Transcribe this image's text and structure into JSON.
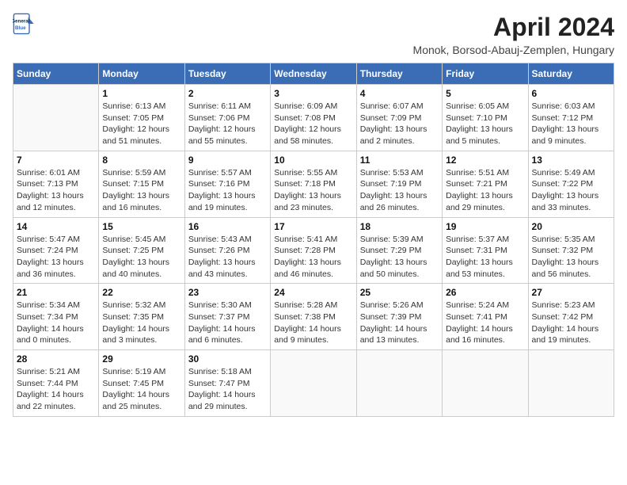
{
  "header": {
    "logo_line1": "General",
    "logo_line2": "Blue",
    "month_title": "April 2024",
    "location": "Monok, Borsod-Abauj-Zemplen, Hungary"
  },
  "weekdays": [
    "Sunday",
    "Monday",
    "Tuesday",
    "Wednesday",
    "Thursday",
    "Friday",
    "Saturday"
  ],
  "weeks": [
    [
      {
        "day": "",
        "info": ""
      },
      {
        "day": "1",
        "info": "Sunrise: 6:13 AM\nSunset: 7:05 PM\nDaylight: 12 hours\nand 51 minutes."
      },
      {
        "day": "2",
        "info": "Sunrise: 6:11 AM\nSunset: 7:06 PM\nDaylight: 12 hours\nand 55 minutes."
      },
      {
        "day": "3",
        "info": "Sunrise: 6:09 AM\nSunset: 7:08 PM\nDaylight: 12 hours\nand 58 minutes."
      },
      {
        "day": "4",
        "info": "Sunrise: 6:07 AM\nSunset: 7:09 PM\nDaylight: 13 hours\nand 2 minutes."
      },
      {
        "day": "5",
        "info": "Sunrise: 6:05 AM\nSunset: 7:10 PM\nDaylight: 13 hours\nand 5 minutes."
      },
      {
        "day": "6",
        "info": "Sunrise: 6:03 AM\nSunset: 7:12 PM\nDaylight: 13 hours\nand 9 minutes."
      }
    ],
    [
      {
        "day": "7",
        "info": "Sunrise: 6:01 AM\nSunset: 7:13 PM\nDaylight: 13 hours\nand 12 minutes."
      },
      {
        "day": "8",
        "info": "Sunrise: 5:59 AM\nSunset: 7:15 PM\nDaylight: 13 hours\nand 16 minutes."
      },
      {
        "day": "9",
        "info": "Sunrise: 5:57 AM\nSunset: 7:16 PM\nDaylight: 13 hours\nand 19 minutes."
      },
      {
        "day": "10",
        "info": "Sunrise: 5:55 AM\nSunset: 7:18 PM\nDaylight: 13 hours\nand 23 minutes."
      },
      {
        "day": "11",
        "info": "Sunrise: 5:53 AM\nSunset: 7:19 PM\nDaylight: 13 hours\nand 26 minutes."
      },
      {
        "day": "12",
        "info": "Sunrise: 5:51 AM\nSunset: 7:21 PM\nDaylight: 13 hours\nand 29 minutes."
      },
      {
        "day": "13",
        "info": "Sunrise: 5:49 AM\nSunset: 7:22 PM\nDaylight: 13 hours\nand 33 minutes."
      }
    ],
    [
      {
        "day": "14",
        "info": "Sunrise: 5:47 AM\nSunset: 7:24 PM\nDaylight: 13 hours\nand 36 minutes."
      },
      {
        "day": "15",
        "info": "Sunrise: 5:45 AM\nSunset: 7:25 PM\nDaylight: 13 hours\nand 40 minutes."
      },
      {
        "day": "16",
        "info": "Sunrise: 5:43 AM\nSunset: 7:26 PM\nDaylight: 13 hours\nand 43 minutes."
      },
      {
        "day": "17",
        "info": "Sunrise: 5:41 AM\nSunset: 7:28 PM\nDaylight: 13 hours\nand 46 minutes."
      },
      {
        "day": "18",
        "info": "Sunrise: 5:39 AM\nSunset: 7:29 PM\nDaylight: 13 hours\nand 50 minutes."
      },
      {
        "day": "19",
        "info": "Sunrise: 5:37 AM\nSunset: 7:31 PM\nDaylight: 13 hours\nand 53 minutes."
      },
      {
        "day": "20",
        "info": "Sunrise: 5:35 AM\nSunset: 7:32 PM\nDaylight: 13 hours\nand 56 minutes."
      }
    ],
    [
      {
        "day": "21",
        "info": "Sunrise: 5:34 AM\nSunset: 7:34 PM\nDaylight: 14 hours\nand 0 minutes."
      },
      {
        "day": "22",
        "info": "Sunrise: 5:32 AM\nSunset: 7:35 PM\nDaylight: 14 hours\nand 3 minutes."
      },
      {
        "day": "23",
        "info": "Sunrise: 5:30 AM\nSunset: 7:37 PM\nDaylight: 14 hours\nand 6 minutes."
      },
      {
        "day": "24",
        "info": "Sunrise: 5:28 AM\nSunset: 7:38 PM\nDaylight: 14 hours\nand 9 minutes."
      },
      {
        "day": "25",
        "info": "Sunrise: 5:26 AM\nSunset: 7:39 PM\nDaylight: 14 hours\nand 13 minutes."
      },
      {
        "day": "26",
        "info": "Sunrise: 5:24 AM\nSunset: 7:41 PM\nDaylight: 14 hours\nand 16 minutes."
      },
      {
        "day": "27",
        "info": "Sunrise: 5:23 AM\nSunset: 7:42 PM\nDaylight: 14 hours\nand 19 minutes."
      }
    ],
    [
      {
        "day": "28",
        "info": "Sunrise: 5:21 AM\nSunset: 7:44 PM\nDaylight: 14 hours\nand 22 minutes."
      },
      {
        "day": "29",
        "info": "Sunrise: 5:19 AM\nSunset: 7:45 PM\nDaylight: 14 hours\nand 25 minutes."
      },
      {
        "day": "30",
        "info": "Sunrise: 5:18 AM\nSunset: 7:47 PM\nDaylight: 14 hours\nand 29 minutes."
      },
      {
        "day": "",
        "info": ""
      },
      {
        "day": "",
        "info": ""
      },
      {
        "day": "",
        "info": ""
      },
      {
        "day": "",
        "info": ""
      }
    ]
  ]
}
